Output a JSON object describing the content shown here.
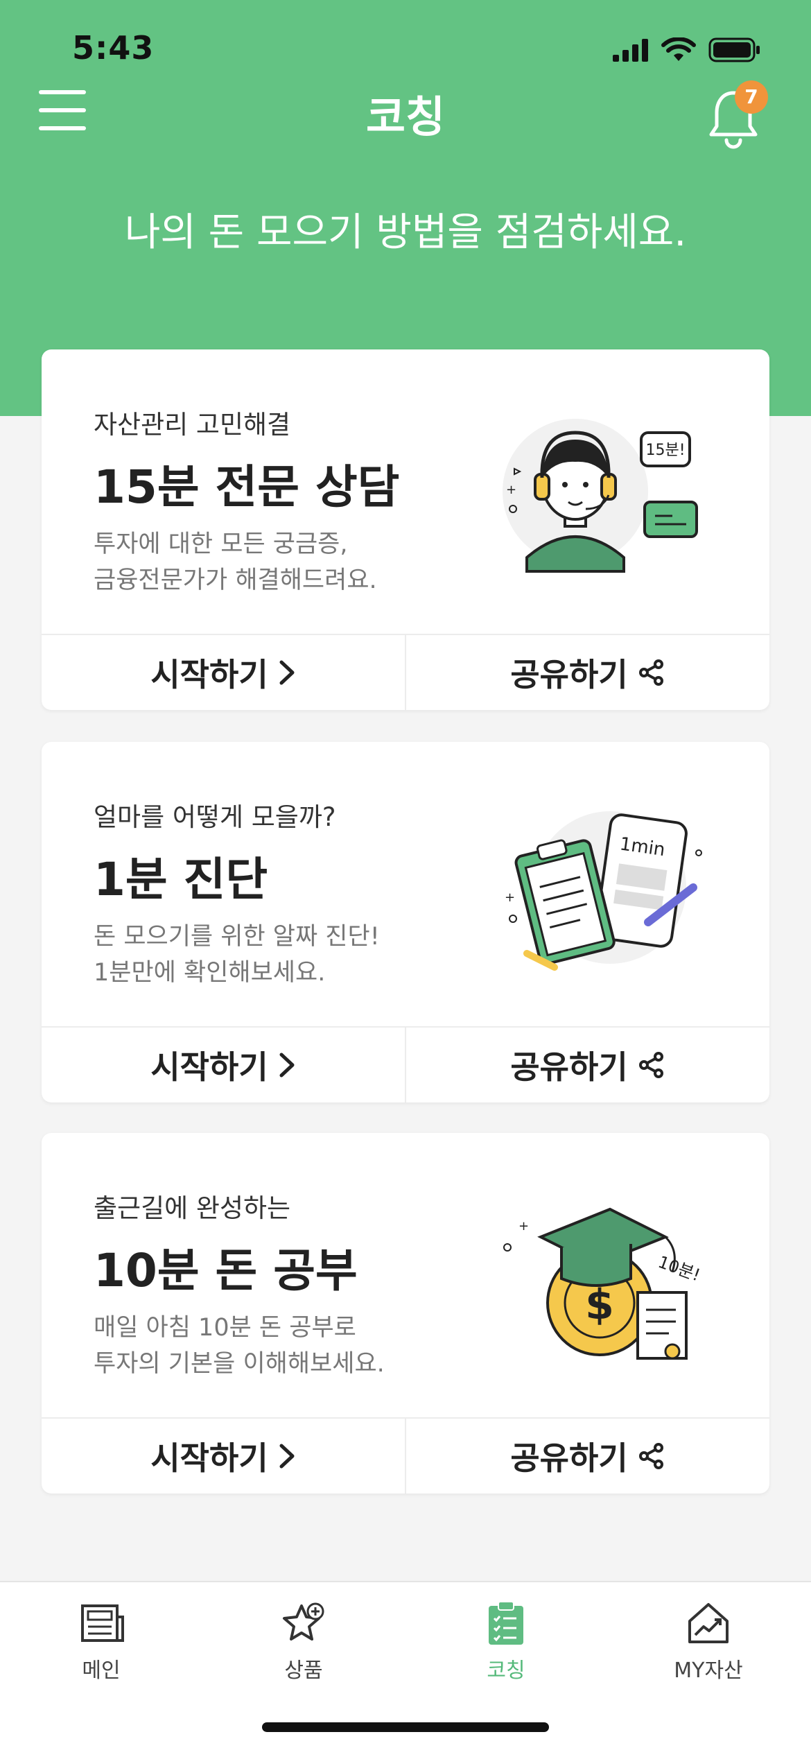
{
  "status": {
    "time": "5:43"
  },
  "header": {
    "title": "코칭",
    "notification_count": "7"
  },
  "subtitle": "나의 돈 모으기 방법을 점검하세요.",
  "cards": [
    {
      "eyebrow": "자산관리 고민해결",
      "title": "15분 전문 상담",
      "desc": [
        "투자에 대한 모든 궁금증,",
        "금융전문가가 해결해드려요."
      ],
      "start_label": "시작하기",
      "share_label": "공유하기",
      "illustration": "counselor-headset-illustration",
      "illustration_text": "15분!"
    },
    {
      "eyebrow": "얼마를 어떻게 모을까?",
      "title": "1분 진단",
      "desc": [
        "돈 모으기를 위한 알짜 진단!",
        "1분만에 확인해보세요."
      ],
      "start_label": "시작하기",
      "share_label": "공유하기",
      "illustration": "clipboard-tablet-illustration",
      "illustration_text": "1min"
    },
    {
      "eyebrow": "출근길에 완성하는",
      "title": "10분 돈 공부",
      "desc": [
        "매일 아침 10분 돈 공부로",
        "투자의 기본을 이해해보세요."
      ],
      "start_label": "시작하기",
      "share_label": "공유하기",
      "illustration": "graduation-coin-illustration",
      "illustration_text": "10분!"
    }
  ],
  "tabs": [
    {
      "label": "메인",
      "icon": "newspaper-icon",
      "active": false
    },
    {
      "label": "상품",
      "icon": "star-plus-icon",
      "active": false
    },
    {
      "label": "코칭",
      "icon": "clipboard-list-icon",
      "active": true
    },
    {
      "label": "MY자산",
      "icon": "house-chart-icon",
      "active": false
    }
  ],
  "colors": {
    "brand_green": "#63c383",
    "badge_orange": "#f0943b",
    "active_tab": "#55b97a"
  }
}
